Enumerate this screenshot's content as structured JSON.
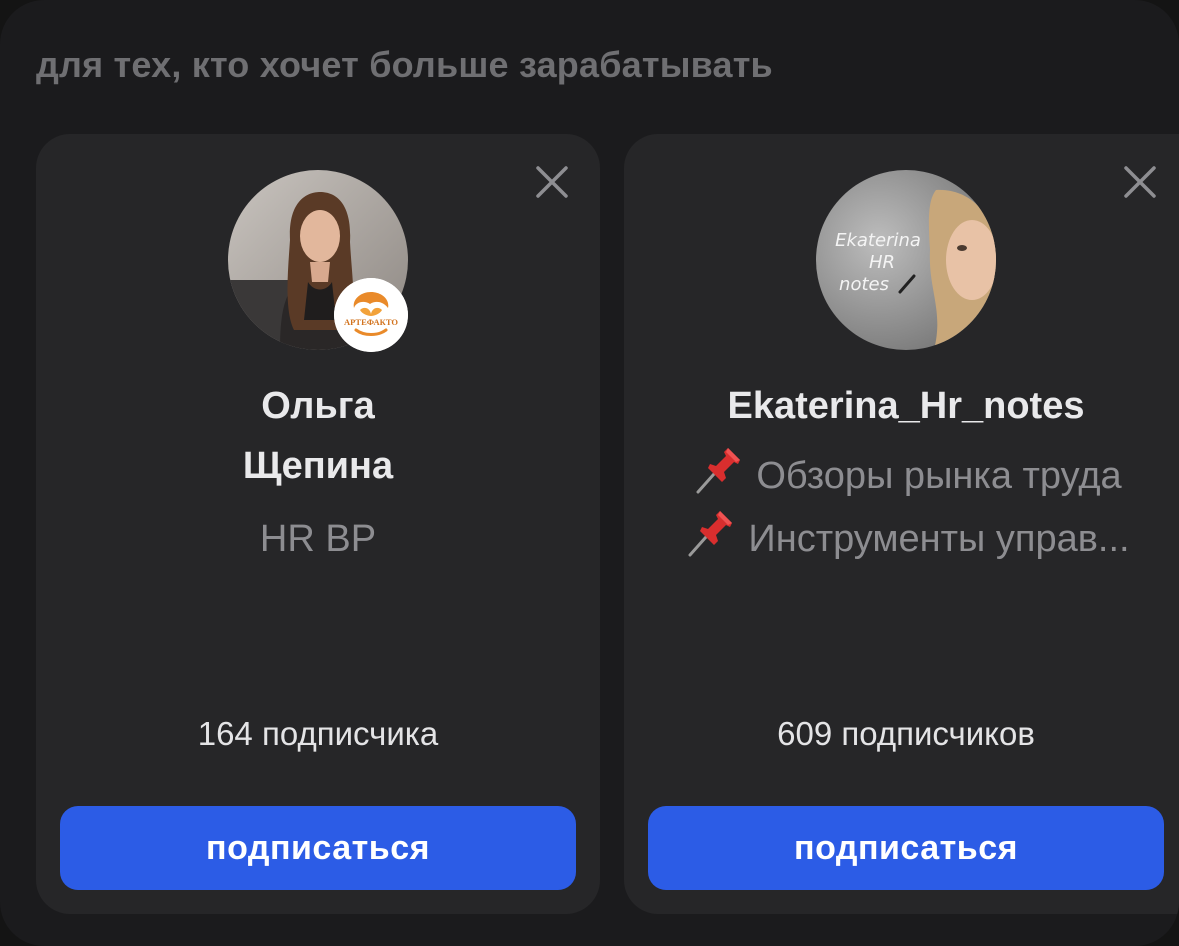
{
  "section": {
    "title": "для тех, кто хочет больше зарабатывать"
  },
  "colors": {
    "background": "#1b1b1d",
    "card": "#262628",
    "accent_button": "#2c5ce6"
  },
  "cards": [
    {
      "name_line1": "Ольга",
      "name_line2": "Щепина",
      "description": "HR BP",
      "badge_text": "АРТЕФАКТО",
      "subscribers": "164 подписчика",
      "subscribe_label": "подписаться",
      "close_icon": "close-icon"
    },
    {
      "name": "Ekaterina_Hr_notes",
      "avatar_text": {
        "line1": "Ekaterina",
        "line2": "HR",
        "line3": "notes"
      },
      "description_lines": [
        "Обзоры рынка труда",
        "Инструменты управ..."
      ],
      "description_icon": "pushpin-icon",
      "subscribers": "609 подписчиков",
      "subscribe_label": "подписаться",
      "close_icon": "close-icon"
    }
  ]
}
